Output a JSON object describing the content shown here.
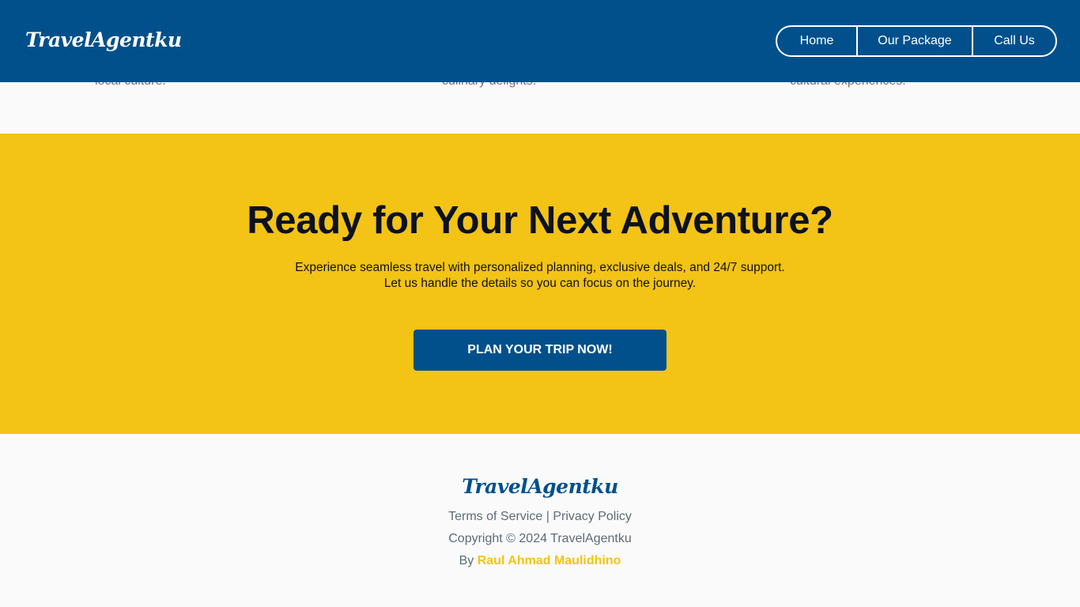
{
  "header": {
    "logo": "TravelAgentku",
    "nav": [
      {
        "label": "Home"
      },
      {
        "label": "Our Package"
      },
      {
        "label": "Call Us"
      }
    ]
  },
  "features": {
    "tails": [
      "local culture.",
      "culinary delights.",
      "cultural experiences."
    ]
  },
  "cta": {
    "title": "Ready for Your Next Adventure?",
    "line1": "Experience seamless travel with personalized planning, exclusive deals, and 24/7 support.",
    "line2": "Let us handle the details so you can focus on the journey.",
    "button": "PLAN YOUR TRIP NOW!"
  },
  "footer": {
    "logo": "TravelAgentku",
    "terms": "Terms of Service",
    "separator": "|",
    "privacy": "Privacy Policy",
    "copyright": "Copyright © 2024 TravelAgentku",
    "by_prefix": "By",
    "author": "Raul Ahmad Maulidhino"
  },
  "colors": {
    "primary": "#01508b",
    "accent": "#f3c316",
    "background": "#fafafa"
  }
}
